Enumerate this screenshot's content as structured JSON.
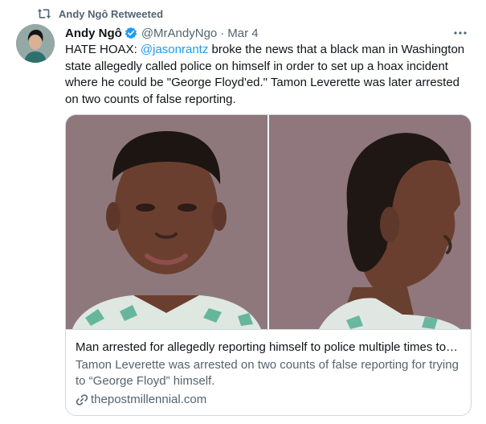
{
  "retweet": {
    "label": "Andy Ngô Retweeted"
  },
  "tweet": {
    "author_name": "Andy Ngô",
    "handle": "@MrAndyNgo",
    "separator": "·",
    "date": "Mar 4",
    "text_before": "HATE HOAX: ",
    "mention": "@jasonrantz",
    "text_after": " broke the news that a black man in Washington state allegedly called police on himself in order to set up a hoax incident where he could be \"George Floyd'ed.\" Tamon Leverette was later arrested on two counts of false reporting."
  },
  "card": {
    "title": "Man arrested for allegedly reporting himself to police multiple times to…",
    "description": "Tamon Leverette was arrested on two counts of false reporting for trying to “George Floyd” himself.",
    "domain": "thepostmillennial.com"
  },
  "icons": {
    "retweet": "retweet-icon",
    "verified": "verified-badge-icon",
    "more": "more-options-icon",
    "link": "link-icon"
  },
  "colors": {
    "accent": "#1d9bf0",
    "secondary_text": "#536471",
    "border": "#cfd9de"
  }
}
